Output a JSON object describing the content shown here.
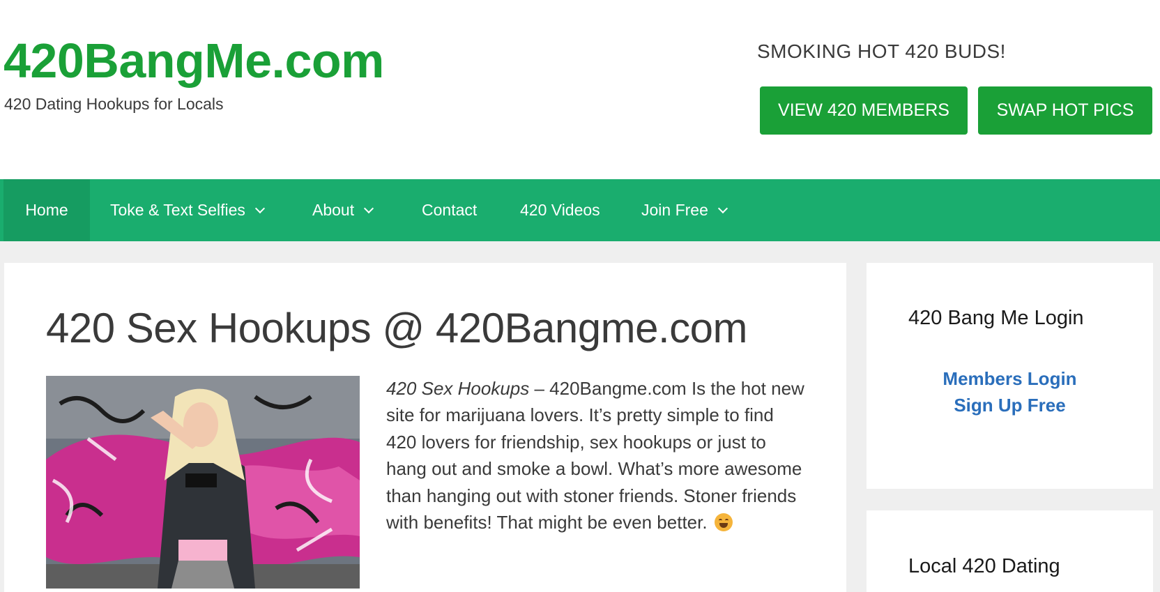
{
  "header": {
    "site_title": "420BangMe.com",
    "tagline": "420 Dating Hookups for Locals",
    "promo_heading": "SMOKING HOT 420 BUDS!",
    "buttons": [
      "VIEW 420 MEMBERS",
      "SWAP HOT PICS"
    ]
  },
  "nav": {
    "items": [
      {
        "label": "Home",
        "active": true,
        "dropdown": false
      },
      {
        "label": "Toke & Text Selfies",
        "active": false,
        "dropdown": true
      },
      {
        "label": "About",
        "active": false,
        "dropdown": true
      },
      {
        "label": "Contact",
        "active": false,
        "dropdown": false
      },
      {
        "label": "420 Videos",
        "active": false,
        "dropdown": false
      },
      {
        "label": "Join Free",
        "active": false,
        "dropdown": true
      }
    ]
  },
  "article": {
    "title": "420 Sex Hookups @ 420Bangme.com",
    "intro_em": "420 Sex Hookups",
    "body": " – 420Bangme.com Is the hot new site for marijuana lovers. It’s pretty simple to find 420 lovers for friendship, sex hookups or just to hang out and smoke a bowl. What’s more awesome than hanging out with stoner friends. Stoner friends with benefits! That might be even better."
  },
  "sidebar": {
    "login_widget": {
      "title": "420 Bang Me Login",
      "links": [
        "Members Login",
        "Sign Up Free"
      ]
    },
    "dating_widget": {
      "title": "Local 420 Dating"
    }
  },
  "colors": {
    "brand_green": "#1aa037",
    "nav_green": "#1aad6e",
    "link_blue": "#2a6ebb"
  }
}
